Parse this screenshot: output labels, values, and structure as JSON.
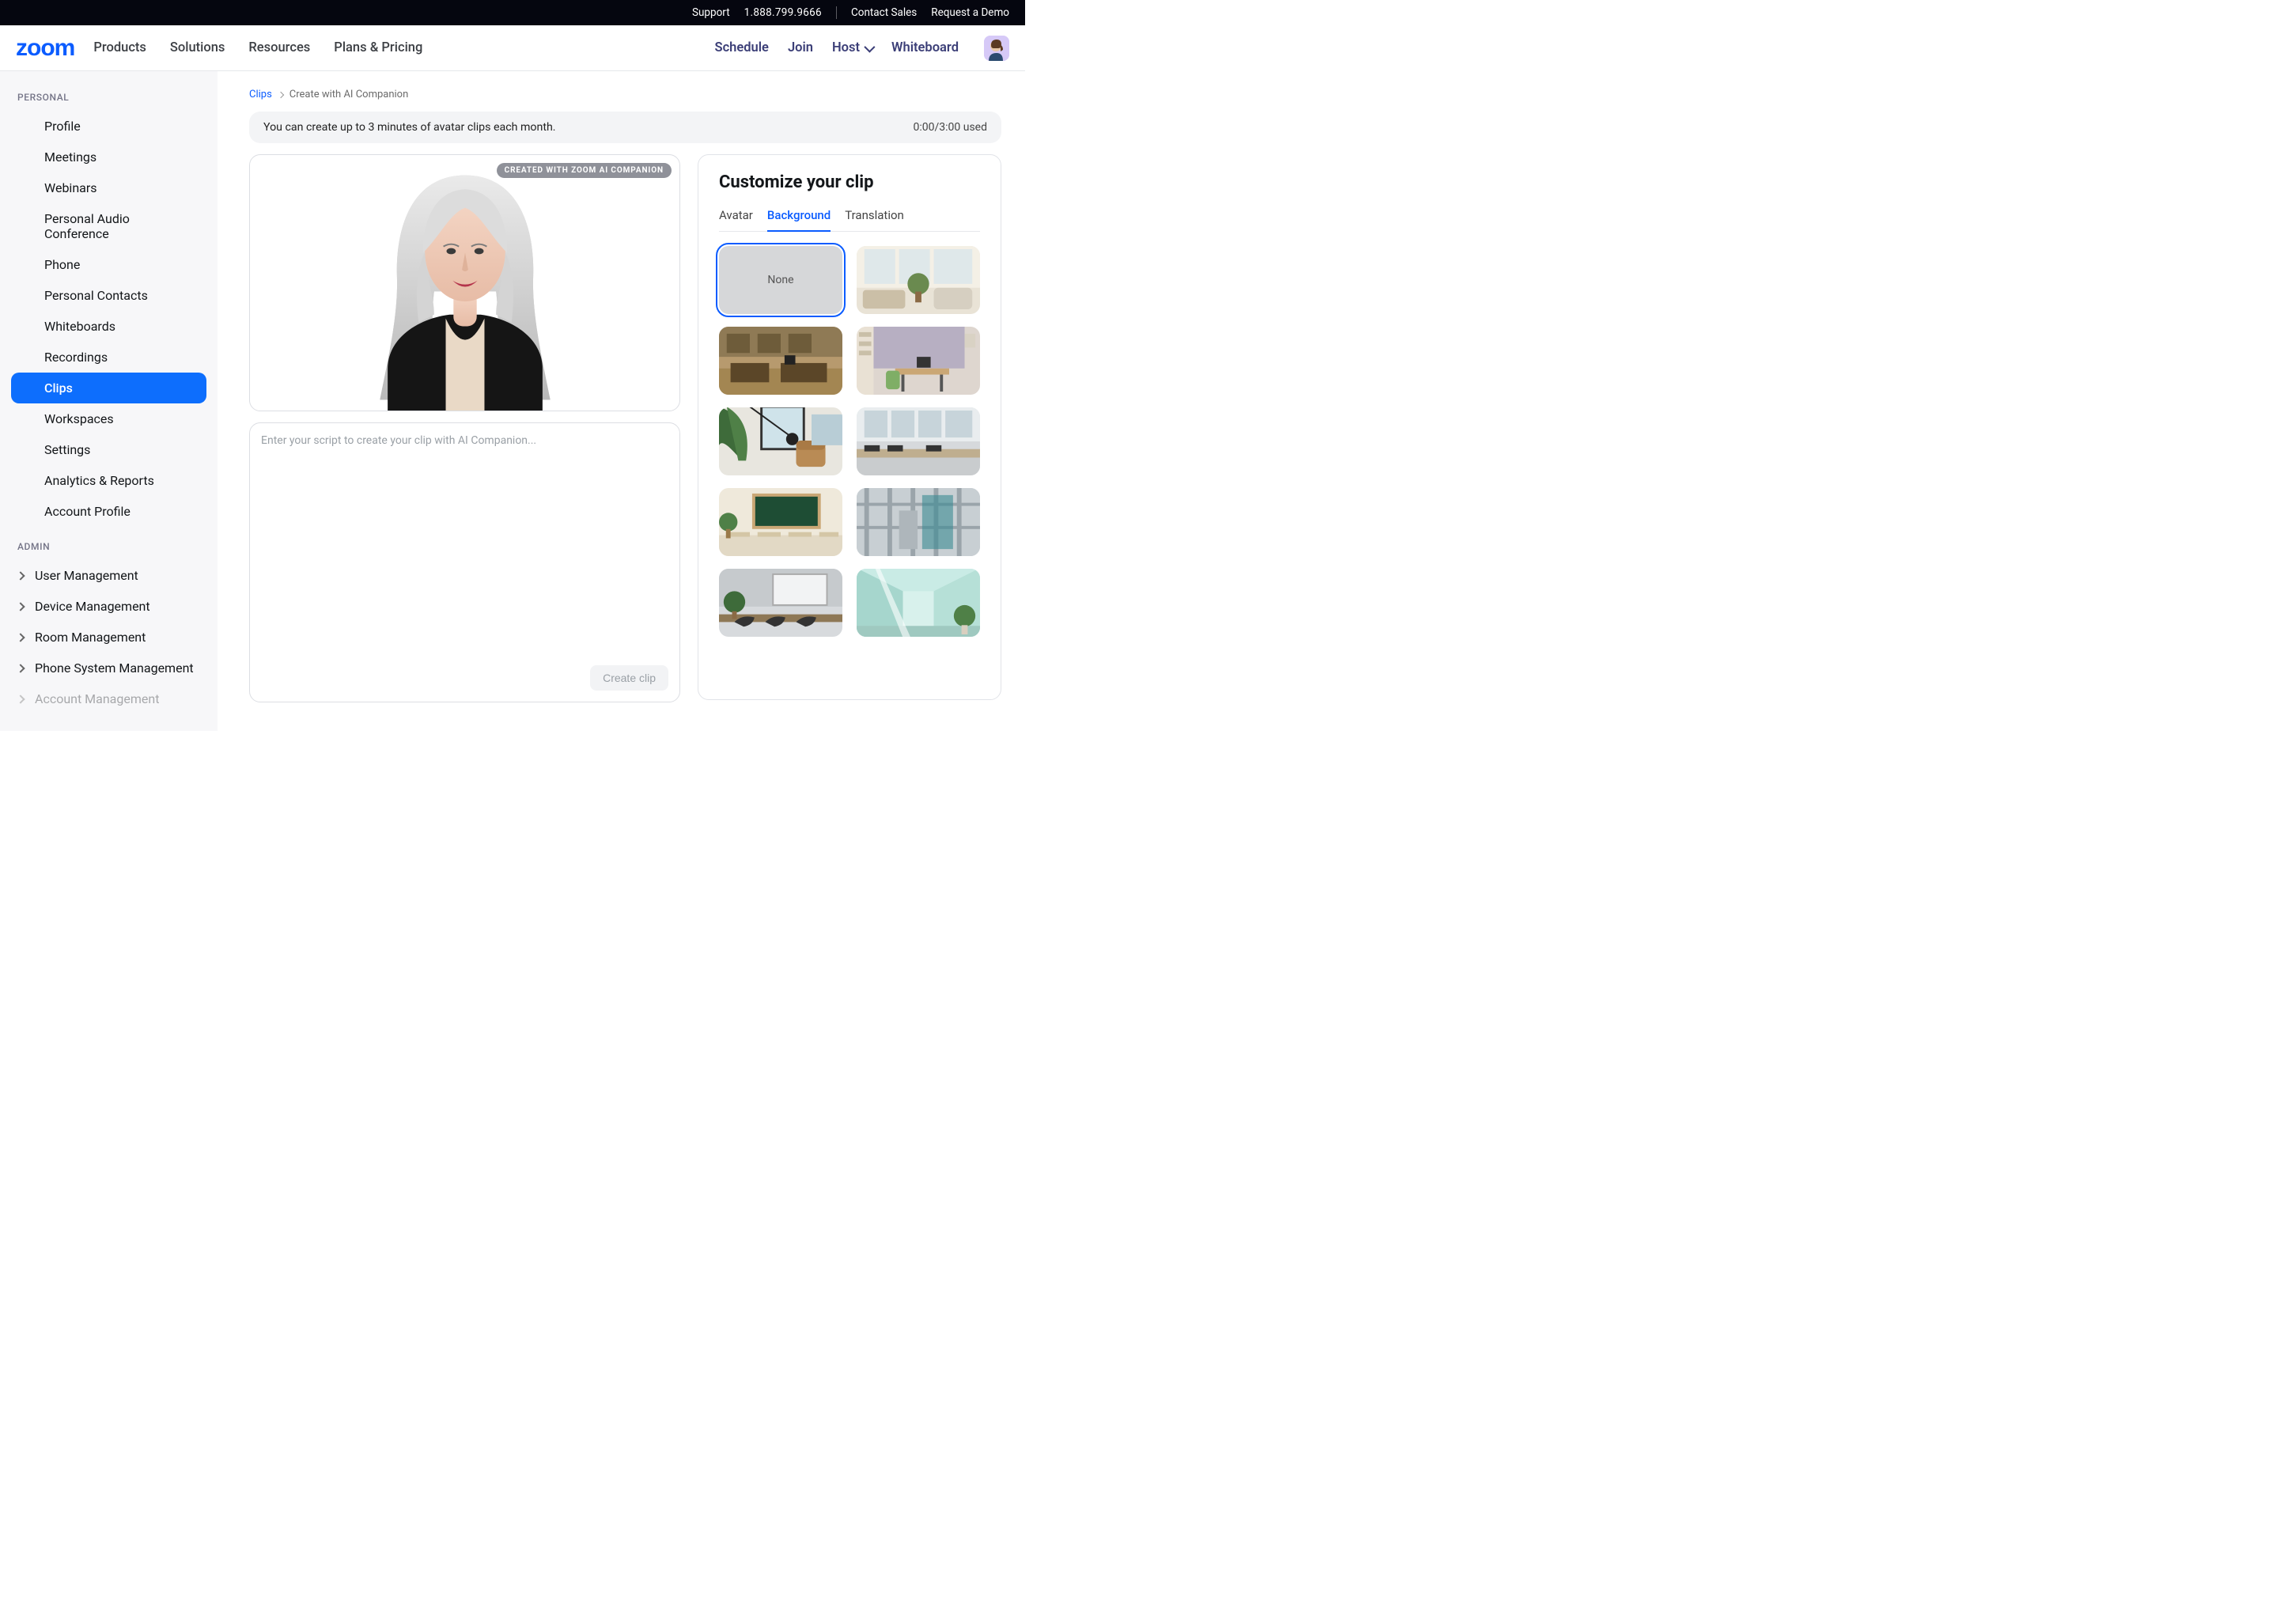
{
  "topbar": {
    "support": "Support",
    "phone": "1.888.799.9666",
    "contact_sales": "Contact Sales",
    "request_demo": "Request a Demo"
  },
  "nav": {
    "logo": "zoom",
    "items": [
      "Products",
      "Solutions",
      "Resources",
      "Plans & Pricing"
    ],
    "right": {
      "schedule": "Schedule",
      "join": "Join",
      "host": "Host",
      "whiteboard": "Whiteboard"
    }
  },
  "sidebar": {
    "personal_label": "PERSONAL",
    "personal_items": [
      "Profile",
      "Meetings",
      "Webinars",
      "Personal Audio Conference",
      "Phone",
      "Personal Contacts",
      "Whiteboards",
      "Recordings",
      "Clips",
      "Workspaces",
      "Settings",
      "Analytics & Reports",
      "Account Profile"
    ],
    "personal_selected_index": 8,
    "admin_label": "ADMIN",
    "admin_items": [
      "User Management",
      "Device Management",
      "Room Management",
      "Phone System Management",
      "Account Management"
    ]
  },
  "breadcrumb": {
    "clips": "Clips",
    "current": "Create with AI Companion"
  },
  "quota": {
    "message": "You can create up to 3 minutes of avatar clips each month.",
    "used": "0:00/3:00 used"
  },
  "preview": {
    "badge": "CREATED WITH ZOOM AI COMPANION"
  },
  "script": {
    "placeholder": "Enter your script to create your clip with AI Companion...",
    "create_label": "Create clip"
  },
  "customize": {
    "title": "Customize your clip",
    "tabs": [
      "Avatar",
      "Background",
      "Translation"
    ],
    "active_tab_index": 1,
    "none_label": "None",
    "background_options": [
      "none",
      "living-room",
      "open-office",
      "studio-desk",
      "sunroom-chair",
      "corporate-openplan",
      "classroom",
      "industrial-warehouse",
      "boardroom",
      "teal-hallway"
    ],
    "selected_background_index": 0
  }
}
